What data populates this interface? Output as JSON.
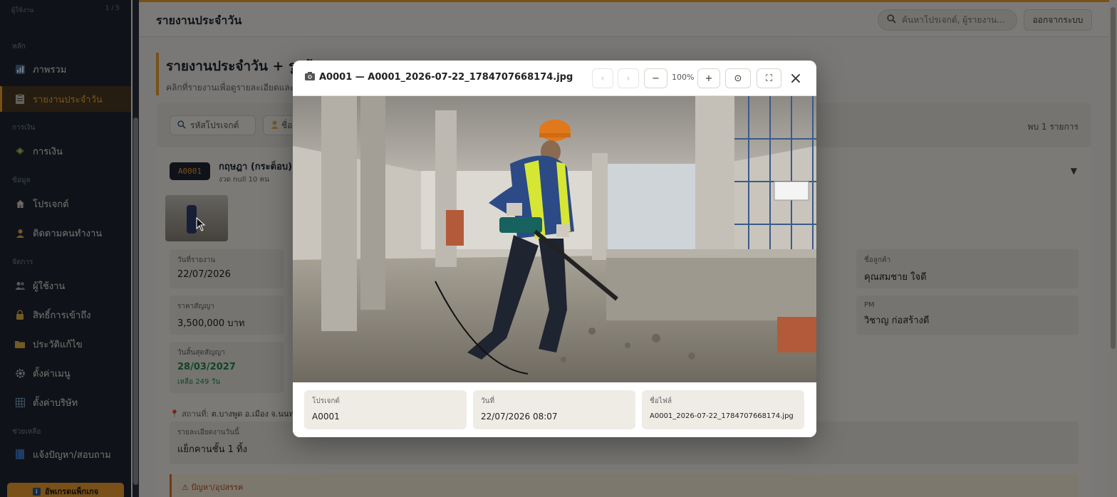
{
  "sidebar": {
    "top_label": "ผู้ใช้งาน",
    "top_page": "1 / 5",
    "sections": {
      "main": "หลัก",
      "finance": "การเงิน",
      "data": "ข้อมูล",
      "manage": "จัดการ",
      "help": "ช่วยเหลือ"
    },
    "items": [
      {
        "label": "ภาพรวม",
        "icon": "chart-icon"
      },
      {
        "label": "รายงานประจำวัน",
        "icon": "clipboard-icon"
      },
      {
        "label": "การเงิน",
        "icon": "money-icon"
      },
      {
        "label": "โปรเจกต์",
        "icon": "home-icon"
      },
      {
        "label": "ติดตามคนทำงาน",
        "icon": "worker-icon"
      },
      {
        "label": "ผู้ใช้งาน",
        "icon": "users-icon"
      },
      {
        "label": "สิทธิ์การเข้าถึง",
        "icon": "lock-icon"
      },
      {
        "label": "ประวัติแก้ไข",
        "icon": "folder-icon"
      },
      {
        "label": "ตั้งค่าเมนู",
        "icon": "gear-icon"
      },
      {
        "label": "ตั้งค่าบริษัท",
        "icon": "building-icon"
      },
      {
        "label": "แจ้งปัญหา/สอบถาม",
        "icon": "book-icon"
      }
    ],
    "upgrade_label": "อัพเกรดแพ็กเกจ"
  },
  "topbar": {
    "title": "รายงานประจำวัน",
    "search_placeholder": "ค้นหาโปรเจกต์, ผู้รายงาน...",
    "logout_label": "ออกจากระบบ"
  },
  "page": {
    "heading": "รายงานประจำวัน + รูปถ้",
    "subheading": "คลิกที่รายงานเพื่อดูรายละเอียดและรู",
    "filter_project_placeholder": "รหัสโปรเจกต์",
    "filter_name_placeholder": "ชื่อ",
    "result_count": "พบ 1 รายการ"
  },
  "report": {
    "project_code": "A0001",
    "project_name": "กฤษฎา (กระต็อบ) -",
    "meta": "งวด null   10 คน",
    "fields": {
      "report_date_label": "วันที่รายงาน",
      "report_date": "22/07/2026",
      "customer_label": "ชื่อลูกค้า",
      "customer": "คุณสมชาย ใจดี",
      "contract_price_label": "ราคาสัญญา",
      "contract_price": "3,500,000 บาท",
      "pm_label": "PM",
      "pm": "วิชาญ ก่อสร้างดี",
      "contract_end_label": "วันสิ้นสุดสัญญา",
      "contract_end": "28/03/2027",
      "days_left": "เหลือ 249 วัน",
      "location_label": "สถานที่:",
      "location": "ต.บางพูด อ.เมือง จ.นนทบุรี",
      "detail_label": "รายละเอียดงานวันนี้",
      "detail": "แย็กคานชั้น 1 ทิ้ง",
      "issue_label": "ปัญหา/อุปสรรค"
    }
  },
  "modal": {
    "title": "A0001 — A0001_2026-07-22_1784707668174.jpg",
    "prev_label": "‹",
    "next_label": "›",
    "zoom_out_label": "−",
    "zoom_level": "100%",
    "zoom_in_label": "+",
    "reset_label": "⊙",
    "fullscreen_label": "⛶",
    "close_label": "×",
    "info": {
      "project_label": "โปรเจกต์",
      "project": "A0001",
      "date_label": "วันที่",
      "date": "22/07/2026 08:07",
      "filename_label": "ชื่อไฟล์",
      "filename": "A0001_2026-07-22_1784707668174.jpg"
    }
  },
  "colors": {
    "accent": "#f0a030",
    "sidebar_bg": "#1f2733",
    "success": "#1f8a4c"
  }
}
